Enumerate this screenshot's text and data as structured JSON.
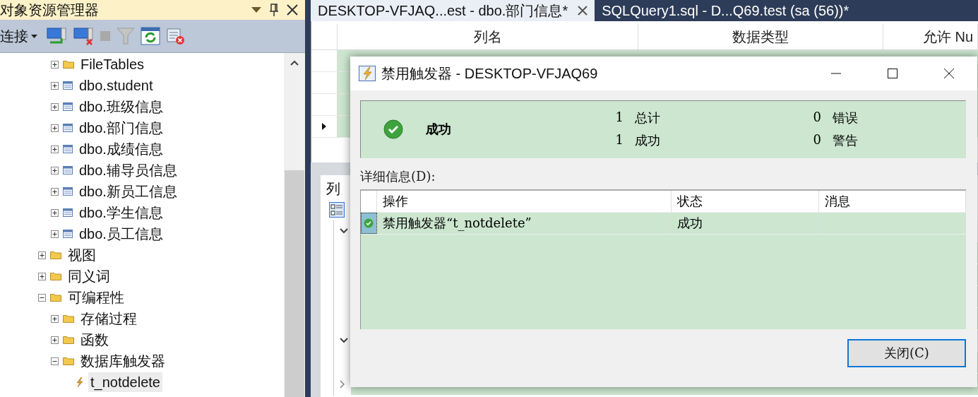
{
  "object_explorer": {
    "title": "对象资源管理器",
    "connect_label": "连接",
    "tree_continued": [
      {
        "label": "FileTables",
        "kind": "folder",
        "expanded": false,
        "selected": false
      },
      {
        "label": "dbo.student",
        "kind": "table",
        "expanded": false,
        "selected": false
      },
      {
        "label": "dbo.班级信息",
        "kind": "table",
        "expanded": false,
        "selected": false
      },
      {
        "label": "dbo.部门信息",
        "kind": "table",
        "expanded": false,
        "selected": false
      },
      {
        "label": "dbo.成绩信息",
        "kind": "table",
        "expanded": false,
        "selected": false
      },
      {
        "label": "dbo.辅导员信息",
        "kind": "table",
        "expanded": false,
        "selected": false
      },
      {
        "label": "dbo.新员工信息",
        "kind": "table",
        "expanded": false,
        "selected": false
      },
      {
        "label": "dbo.学生信息",
        "kind": "table",
        "expanded": false,
        "selected": false
      },
      {
        "label": "dbo.员工信息",
        "kind": "table",
        "expanded": false,
        "selected": false
      }
    ],
    "tree": [
      {
        "label": "视图",
        "kind": "folder",
        "expanded": false,
        "selected": false
      },
      {
        "label": "同义词",
        "kind": "folder",
        "expanded": false,
        "selected": false
      },
      {
        "label": "可编程性",
        "kind": "folder",
        "expanded": true,
        "selected": false,
        "children": [
          {
            "label": "存储过程",
            "kind": "folder",
            "expanded": false,
            "selected": false
          },
          {
            "label": "函数",
            "kind": "folder",
            "expanded": false,
            "selected": false
          },
          {
            "label": "数据库触发器",
            "kind": "folder",
            "expanded": true,
            "selected": false,
            "children": [
              {
                "label": "t_notdelete",
                "kind": "trigger",
                "selected": true
              }
            ]
          }
        ]
      }
    ]
  },
  "tabs": [
    {
      "label": "DESKTOP-VFJAQ...est - dbo.部门信息*",
      "selected": true
    },
    {
      "label": "SQLQuery1.sql - D...Q69.test (sa (56))*",
      "selected": false
    }
  ],
  "designer": {
    "columns": [
      "列名",
      "数据类型",
      "允许 Nu"
    ],
    "rows": [
      {
        "current": false
      },
      {
        "current": false
      },
      {
        "current": false
      },
      {
        "current": true
      }
    ],
    "properties_tab": "列"
  },
  "dialog": {
    "title": "禁用触发器 - DESKTOP-VFJAQ69",
    "status": "成功",
    "counts": [
      {
        "count": "1",
        "label": "总计"
      },
      {
        "count": "0",
        "label": "错误"
      },
      {
        "count": "1",
        "label": "成功"
      },
      {
        "count": "0",
        "label": "警告"
      }
    ],
    "details_label": "详细信息(D):",
    "columns": [
      "操作",
      "状态",
      "消息"
    ],
    "rows": [
      {
        "action": "禁用触发器“t_notdelete”",
        "status": "成功",
        "selected": true
      }
    ],
    "close_button": "关闭(C)"
  }
}
